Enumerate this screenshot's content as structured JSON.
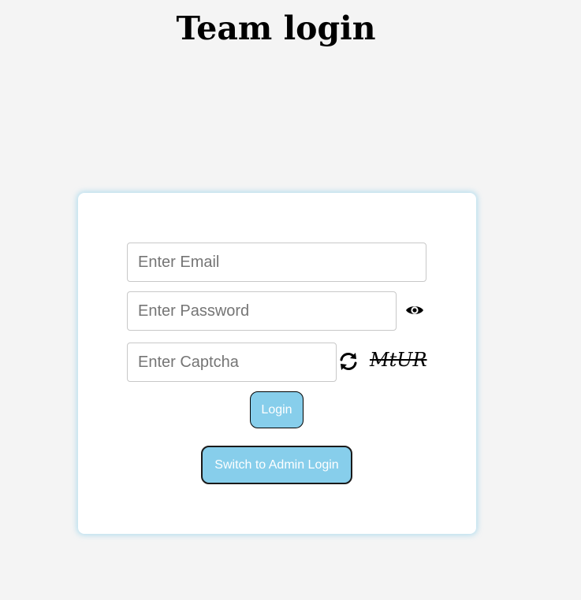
{
  "page": {
    "title": "Team login"
  },
  "form": {
    "email_placeholder": "Enter Email",
    "password_placeholder": "Enter Password",
    "captcha_placeholder": "Enter Captcha",
    "captcha_code": "MtUR",
    "login_label": "Login",
    "switch_label": "Switch to Admin Login"
  },
  "icons": {
    "password_toggle": "eye-icon",
    "captcha_refresh": "refresh-icon"
  },
  "colors": {
    "background": "#f4f4f4",
    "card": "#ffffff",
    "button": "#87ceeb",
    "button_text": "#ffffff",
    "card_glow": "#87ceeb"
  }
}
